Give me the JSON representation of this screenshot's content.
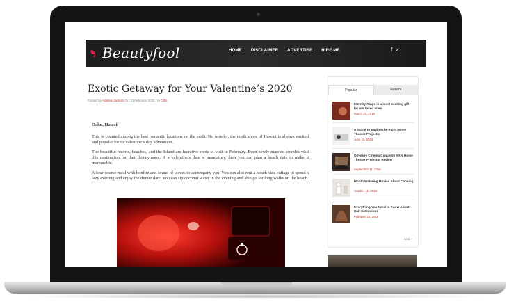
{
  "header": {
    "logo_text": "Beautyfool",
    "nav": [
      "HOME",
      "DISCLAIMER",
      "ADVERTISE",
      "HIRE ME"
    ],
    "social": [
      "facebook-icon",
      "twitter-icon"
    ]
  },
  "article": {
    "title": "Exotic Getaway for Your Valentine’s 2020",
    "meta_prefix": "Posted by ",
    "meta_author": "Adeline Jackobi",
    "meta_on": " On 10 February 2020 | In ",
    "meta_category": "Gifts",
    "heading": "Oahu, Hawaii",
    "paragraphs": [
      "This is counted among the best romantic locations on the earth. No wonder, the north shore of Hawaii is always excited and popular for its valentine’s day adventures.",
      "The beautiful resorts, beaches, and the Island are lucrative spots to visit in February. Even newly married couples visit this destination for their honeymoon. If a valentine’s date is mandatory, then you can plan a beach date to make it memorable.",
      "A four-course meal with bonfire and sound of waves to accompany you. You can also rent a beach-side cottage to spend a lazy evening and enjoy the dinner date. You can sip coconut water in the evening and also go for long walks on the beach."
    ]
  },
  "sidebar": {
    "tabs": [
      "Popular",
      "Recent"
    ],
    "items": [
      {
        "title": "Eternity Rings is a most exciting gift for our loved ones",
        "date": "March 19, 2016"
      },
      {
        "title": "A Guide to Buying the Right Home Theater Projector",
        "date": "June 18, 2016"
      },
      {
        "title": "Odyssey Cinema Concepts VX-9 Home Theater Projector Review",
        "date": "September 11, 2016"
      },
      {
        "title": "Mouth Watering Movies About Cooking",
        "date": "October 11, 2016"
      },
      {
        "title": "Everything You Need to Know About Hair Extensions",
        "date": "February 26, 2016"
      }
    ],
    "next_label": "next »"
  }
}
